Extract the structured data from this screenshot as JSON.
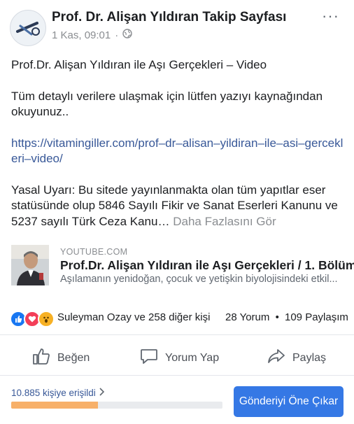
{
  "post": {
    "page_name": "Prof. Dr. Alişan Yıldıran Takip Sayfası",
    "date": "1 Kas, 09:01",
    "separator": "·",
    "audience_icon": "globe-icon",
    "more_label": "···",
    "title_line": "Prof.Dr. Alişan Yıldıran ile Aşı Gerçekleri – Video",
    "detail_line": "Tüm detaylı verilere ulaşmak için lütfen yazıyı kaynağından okuyunuz..",
    "link": "https://vitamingiller.com/prof–dr–alisan–yildiran–ile–asi–gercekleri–video/",
    "warning": "Yasal Uyarı: Bu sitede yayınlanmakta olan tüm yapıtlar eser statüsünde olup 5846 Sayılı Fikir ve Sanat Eserleri Kanunu ve 5237 sayılı Türk Ceza Kanu…",
    "see_more": "Daha Fazlasını Gör"
  },
  "preview": {
    "domain": "YOUTUBE.COM",
    "title": "Prof.Dr. Alişan Yıldıran ile Aşı Gerçekleri / 1. Bölüm",
    "description": "Aşılamanın yenidoğan, çocuk ve yetişkin biyolojisindeki etkil..."
  },
  "engagement": {
    "reaction_icons": [
      "like-icon",
      "love-icon",
      "wow-icon"
    ],
    "reactors": "Suleyman Ozay ve 258 diğer kişi",
    "comments": "28 Yorum",
    "dot": "•",
    "shares": "109 Paylaşım"
  },
  "actions": {
    "like": "Beğen",
    "comment": "Yorum Yap",
    "share": "Paylaş"
  },
  "insights": {
    "reach_label": "10.885 kişiye erişildi",
    "reach_progress": 0.41,
    "boost_label": "Gönderiyi Öne Çıkar"
  },
  "colors": {
    "link": "#385898",
    "boost": "#3578e5",
    "progress": "#f7b069"
  }
}
